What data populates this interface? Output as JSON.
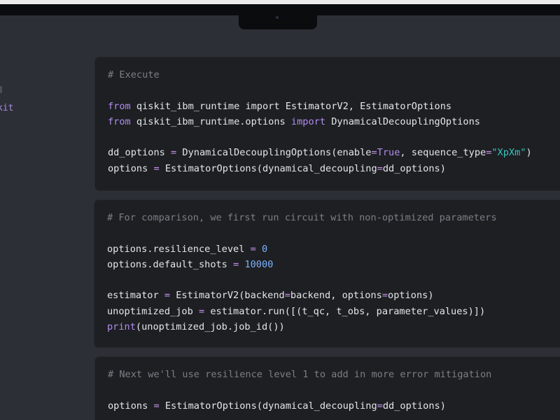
{
  "sidebar": {
    "partial_text": "kit"
  },
  "colors": {
    "background": "#2c2f35",
    "cell_background": "#1d1f22",
    "comment": "#7a7f88",
    "keyword": "#b28cf0",
    "number": "#7cb2ff",
    "string": "#36c4c0",
    "text": "#e4e6ea"
  },
  "cells": [
    {
      "lines": [
        [
          {
            "t": "comment",
            "v": "# Execute"
          }
        ],
        [],
        [
          {
            "t": "kw",
            "v": "from"
          },
          {
            "t": "plain",
            "v": " qiskit_ibm_runtime "
          },
          {
            "t": "plain",
            "v": "import"
          },
          {
            "t": "plain",
            "v": " EstimatorV2, EstimatorOptions"
          }
        ],
        [
          {
            "t": "kw",
            "v": "from"
          },
          {
            "t": "plain",
            "v": " qiskit_ibm_runtime.options "
          },
          {
            "t": "kw",
            "v": "import"
          },
          {
            "t": "plain",
            "v": " DynamicalDecouplingOptions"
          }
        ],
        [],
        [
          {
            "t": "plain",
            "v": "dd_options "
          },
          {
            "t": "op",
            "v": "="
          },
          {
            "t": "plain",
            "v": " DynamicalDecouplingOptions(enable"
          },
          {
            "t": "op",
            "v": "="
          },
          {
            "t": "kw",
            "v": "True"
          },
          {
            "t": "plain",
            "v": ", sequence_type"
          },
          {
            "t": "op",
            "v": "="
          },
          {
            "t": "str",
            "v": "\"XpXm\""
          },
          {
            "t": "plain",
            "v": ")"
          }
        ],
        [
          {
            "t": "plain",
            "v": "options "
          },
          {
            "t": "op",
            "v": "="
          },
          {
            "t": "plain",
            "v": " EstimatorOptions(dynamical_decoupling"
          },
          {
            "t": "op",
            "v": "="
          },
          {
            "t": "plain",
            "v": "dd_options)"
          }
        ]
      ]
    },
    {
      "lines": [
        [
          {
            "t": "comment",
            "v": "# For comparison, we first run circuit with non-optimized parameters"
          }
        ],
        [],
        [
          {
            "t": "plain",
            "v": "options.resilience_level "
          },
          {
            "t": "op",
            "v": "="
          },
          {
            "t": "plain",
            "v": " "
          },
          {
            "t": "num",
            "v": "0"
          }
        ],
        [
          {
            "t": "plain",
            "v": "options.default_shots "
          },
          {
            "t": "op",
            "v": "="
          },
          {
            "t": "plain",
            "v": " "
          },
          {
            "t": "num",
            "v": "10000"
          }
        ],
        [],
        [
          {
            "t": "plain",
            "v": "estimator "
          },
          {
            "t": "op",
            "v": "="
          },
          {
            "t": "plain",
            "v": " EstimatorV2(backend"
          },
          {
            "t": "op",
            "v": "="
          },
          {
            "t": "plain",
            "v": "backend, options"
          },
          {
            "t": "op",
            "v": "="
          },
          {
            "t": "plain",
            "v": "options)"
          }
        ],
        [
          {
            "t": "plain",
            "v": "unoptimized_job "
          },
          {
            "t": "op",
            "v": "="
          },
          {
            "t": "plain",
            "v": " estimator.run([(t_qc, t_obs, parameter_values)])"
          }
        ],
        [
          {
            "t": "kw",
            "v": "print"
          },
          {
            "t": "plain",
            "v": "(unoptimized_job.job_id())"
          }
        ]
      ]
    },
    {
      "lines": [
        [
          {
            "t": "comment",
            "v": "# Next we'll use resilience level 1 to add in more error mitigation"
          }
        ],
        [],
        [
          {
            "t": "plain",
            "v": "options "
          },
          {
            "t": "op",
            "v": "="
          },
          {
            "t": "plain",
            "v": " EstimatorOptions(dynamical_decoupling"
          },
          {
            "t": "op",
            "v": "="
          },
          {
            "t": "plain",
            "v": "dd_options)"
          }
        ]
      ]
    }
  ]
}
